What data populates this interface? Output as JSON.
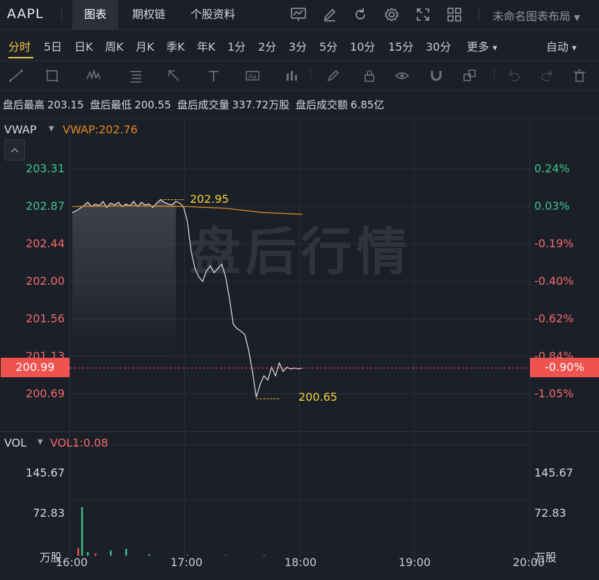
{
  "header": {
    "ticker": "AAPL",
    "tabs": [
      "图表",
      "期权链",
      "个股资料"
    ],
    "active_tab": "图表",
    "layout_name": "未命名图表布局",
    "icons": [
      "indicator-icon",
      "draw-icon",
      "refresh-icon",
      "settings-icon",
      "fullscreen-icon",
      "layout-grid-icon",
      "chevron-down-icon"
    ]
  },
  "periods": {
    "items": [
      "分时",
      "5日",
      "日K",
      "周K",
      "月K",
      "季K",
      "年K",
      "1分",
      "2分",
      "3分",
      "5分",
      "10分",
      "15分",
      "30分",
      "更多"
    ],
    "active": "分时",
    "more_arrow": "▾",
    "mode": "自动",
    "mode_arrow": "▾"
  },
  "drawing_tools": [
    "trend-line-icon",
    "rectangle-icon",
    "pattern-icon",
    "fib-icon",
    "arrow-icon",
    "text-icon",
    "price-label-icon",
    "bars-icon",
    "brush-icon",
    "lock-icon",
    "eye-icon",
    "magnet-icon",
    "copy-icon",
    "undo-icon",
    "redo-icon",
    "delete-icon"
  ],
  "info": {
    "high_label": "盘后最高",
    "high_value": "203.15",
    "low_label": "盘后最低",
    "low_value": "200.55",
    "volume_label": "盘后成交量",
    "volume_value": "337.72万股",
    "amount_label": "盘后成交额",
    "amount_value": "6.85亿"
  },
  "chart_data": {
    "type": "line",
    "watermark": "盘后行情",
    "indicator": {
      "name": "VWAP",
      "value_label": "VWAP:202.76"
    },
    "price_axis_left": [
      "203.31",
      "202.87",
      "202.44",
      "202.00",
      "201.56",
      "201.13",
      "200.69"
    ],
    "price_axis_right": [
      "0.24%",
      "0.03%",
      "-0.19%",
      "-0.40%",
      "-0.62%",
      "-0.84%",
      "-1.05%"
    ],
    "current_price": "200.99",
    "current_pct": "-0.90%",
    "high_marker": "202.95",
    "low_marker": "200.65",
    "x_ticks": [
      "16:00",
      "17:00",
      "18:00",
      "19:00",
      "20:00"
    ],
    "ylim": [
      200.55,
      203.45
    ],
    "price_series": {
      "x": [
        "16:00",
        "16:02",
        "16:04",
        "16:06",
        "16:08",
        "16:10",
        "16:12",
        "16:14",
        "16:16",
        "16:18",
        "16:20",
        "16:22",
        "16:24",
        "16:26",
        "16:28",
        "16:30",
        "16:32",
        "16:34",
        "16:36",
        "16:38",
        "16:40",
        "16:42",
        "16:44",
        "16:46",
        "16:48",
        "16:50",
        "16:52",
        "16:54",
        "16:56",
        "16:58",
        "17:00",
        "17:02",
        "17:04",
        "17:06",
        "17:08",
        "17:10",
        "17:12",
        "17:14",
        "17:16",
        "17:18",
        "17:20",
        "17:22",
        "17:24",
        "17:26",
        "17:28",
        "17:30",
        "17:32",
        "17:34",
        "17:36",
        "17:38",
        "17:40",
        "17:42",
        "17:44",
        "17:46",
        "17:48",
        "17:50",
        "17:52",
        "17:54",
        "17:56",
        "17:58",
        "18:00"
      ],
      "values": [
        202.8,
        202.82,
        202.85,
        202.88,
        202.92,
        202.87,
        202.9,
        202.88,
        202.93,
        202.86,
        202.91,
        202.89,
        202.92,
        202.87,
        202.9,
        202.88,
        202.93,
        202.87,
        202.92,
        202.89,
        202.9,
        202.86,
        202.91,
        202.95,
        202.92,
        202.9,
        202.89,
        202.93,
        202.91,
        202.87,
        202.7,
        202.35,
        202.15,
        202.05,
        202.0,
        202.12,
        202.18,
        202.1,
        202.15,
        202.2,
        202.05,
        201.8,
        201.5,
        201.45,
        201.42,
        201.38,
        201.2,
        200.95,
        200.65,
        200.8,
        200.9,
        200.85,
        201.0,
        200.9,
        201.05,
        200.95,
        201.0,
        200.98,
        200.99,
        200.98,
        200.99
      ]
    },
    "vwap_series": {
      "x": [
        "16:00",
        "16:30",
        "17:00",
        "17:20",
        "17:40",
        "18:00"
      ],
      "values": [
        202.87,
        202.88,
        202.87,
        202.85,
        202.8,
        202.78
      ]
    },
    "volume": {
      "indicator_name": "VOL",
      "value_label": "VOL1:0.08",
      "axis_left": [
        "145.67",
        "72.83"
      ],
      "axis_right": [
        "145.67",
        "72.83"
      ],
      "unit_left": "万股",
      "unit_right": "万股",
      "ylim": [
        0,
        160
      ],
      "bars": [
        {
          "x": "16:03",
          "v": 10,
          "c": "red"
        },
        {
          "x": "16:05",
          "v": 64,
          "c": "green"
        },
        {
          "x": "16:08",
          "v": 5,
          "c": "green"
        },
        {
          "x": "16:12",
          "v": 3,
          "c": "red"
        },
        {
          "x": "16:20",
          "v": 7,
          "c": "green"
        },
        {
          "x": "16:28",
          "v": 9,
          "c": "green"
        },
        {
          "x": "16:40",
          "v": 2,
          "c": "green"
        },
        {
          "x": "17:00",
          "v": 1,
          "c": "red"
        },
        {
          "x": "17:20",
          "v": 1,
          "c": "red"
        },
        {
          "x": "17:40",
          "v": 1,
          "c": "red"
        }
      ]
    }
  },
  "colors": {
    "accent": "#f5c744",
    "up": "#3fc48b",
    "down": "#ef5350",
    "vwap": "#e08a1e",
    "line": "#e8e8e8"
  }
}
